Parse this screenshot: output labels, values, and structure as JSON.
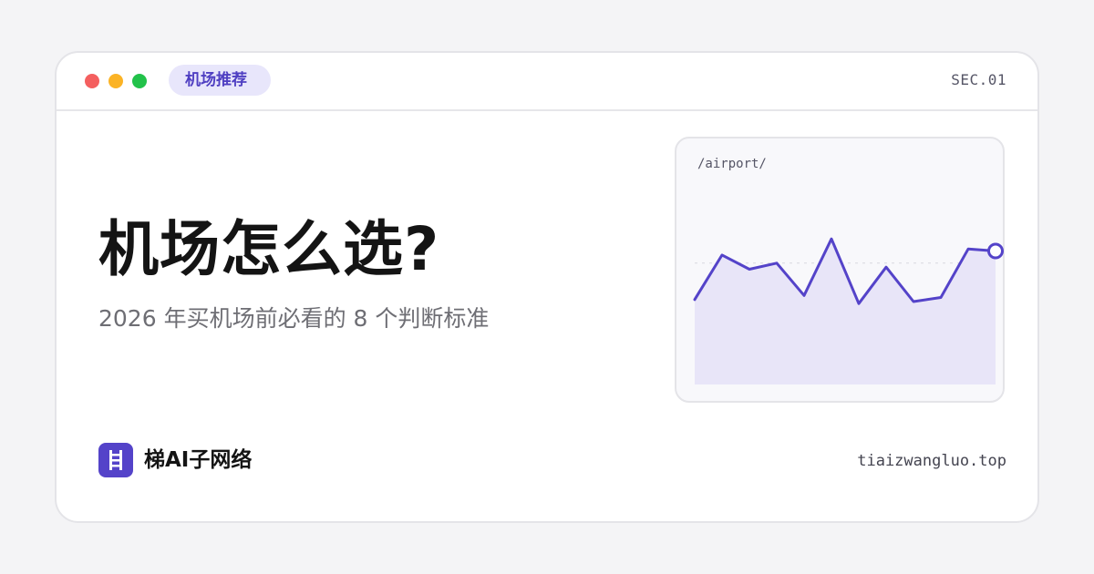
{
  "window": {
    "tag": "机场推荐",
    "section": "SEC.01",
    "colors": {
      "close": "#f45f5f",
      "minimize": "#fbb325",
      "maximize": "#22c24a",
      "accent": "#5443c9"
    }
  },
  "main": {
    "title": "机场怎么选?",
    "subtitle": "2026 年买机场前必看的 8 个判断标准"
  },
  "chart_data": {
    "type": "area",
    "label": "/airport/",
    "values": [
      42,
      64,
      57,
      60,
      44,
      72,
      40,
      58,
      41,
      43,
      67,
      66
    ],
    "ylim": [
      0,
      100
    ],
    "grid": "dashed horizontal",
    "line_color": "#5443c9",
    "fill_color": "#e8e5f8"
  },
  "footer": {
    "brand": "梯AI子网络",
    "brand_icon": "ladder-icon",
    "domain": "tiaizwangluo.top"
  }
}
